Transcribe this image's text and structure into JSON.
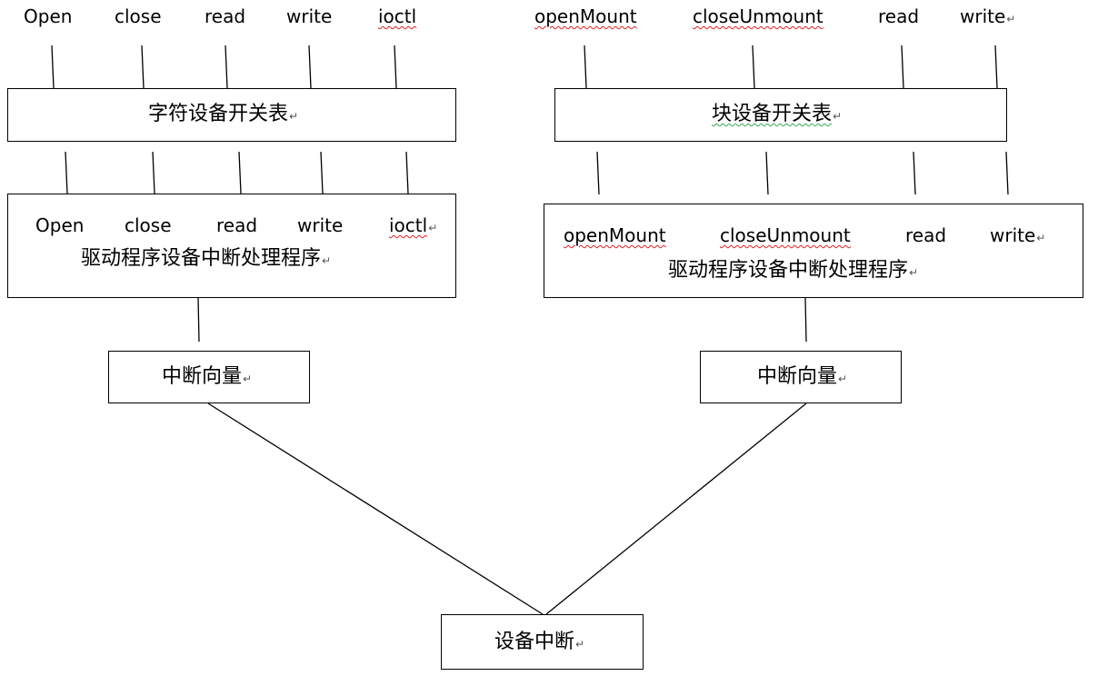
{
  "pilcrow": "↵",
  "char_side": {
    "top_ops": [
      "Open",
      "close",
      "read",
      "write",
      "ioctl"
    ],
    "switch_table": "字符设备开关表",
    "driver_ops": [
      "Open",
      "close",
      "read",
      "write",
      "ioctl"
    ],
    "driver_title": "驱动程序设备中断处理程序",
    "vector": "中断向量"
  },
  "block_side": {
    "top_ops": [
      "openMount",
      "closeUnmount",
      "read",
      "write"
    ],
    "switch_table": "块设备开关表",
    "driver_ops": [
      "openMount",
      "closeUnmount",
      "read",
      "write"
    ],
    "driver_title": "驱动程序设备中断处理程序",
    "vector": "中断向量"
  },
  "device_interrupt": "设备中断",
  "colors": {
    "line": "#000000",
    "spell_error": "#e02020",
    "grammar_mark": "#3aa655"
  }
}
